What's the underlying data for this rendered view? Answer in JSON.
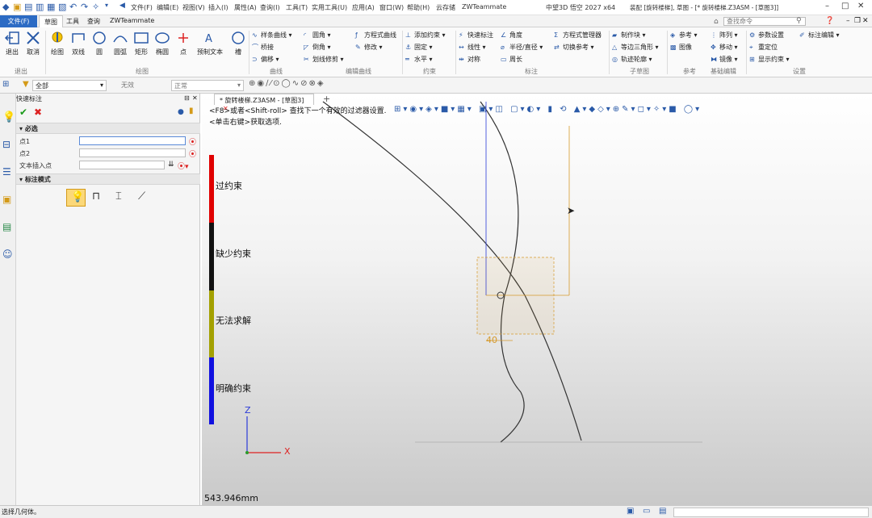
{
  "titlebar": {
    "menus": [
      "文件(F)",
      "编辑(E)",
      "视图(V)",
      "插入(I)",
      "属性(A)",
      "查询(I)",
      "工具(T)",
      "实用工具(U)",
      "应用(A)",
      "窗口(W)",
      "帮助(H)",
      "云存储",
      "ZWTeammate"
    ],
    "app_title": "中望3D 悟空 2027 x64",
    "doc_title": "装配 [旋转楼梯], 草图 - [* 旋转楼梯.Z3ASM - [草图3]]"
  },
  "tabs": {
    "file": "文件(F)",
    "items": [
      "草图",
      "工具",
      "查询",
      "ZWTeammate"
    ],
    "search_placeholder": "查找命令"
  },
  "ribbon": {
    "exit": "退出",
    "cancel": "取消",
    "draw": "绘图",
    "polyline": "双线",
    "circle": "圆",
    "arc": "圆弧",
    "rect": "矩形",
    "ellipse": "椭圆",
    "point": "点",
    "predraw_text": "预制文本",
    "slot": "槽",
    "spline": "样条曲线",
    "bridge": "桥接",
    "offset": "偏移",
    "fillet": "圆角",
    "chamfer": "倒角",
    "trim": "划线修剪",
    "eq_curve": "方程式曲线",
    "modify": "修改",
    "add_constraint": "添加约束",
    "fixed": "固定",
    "horizontal": "水平",
    "quick_dim": "快速标注",
    "linear": "线性",
    "symmetric": "对称",
    "angle": "角度",
    "radius": "半径/直径",
    "perimeter": "周长",
    "eq_manager": "方程式管理器",
    "switch_ref": "切换参考",
    "make_block": "制作块",
    "equal_tri": "等边三角形",
    "track_contour": "轨迹轮廓",
    "reference": "参考",
    "image": "图像",
    "array": "阵列",
    "move": "移动",
    "mirror": "镜像",
    "param_settings": "参数设置",
    "relocate": "重定位",
    "show_constraint": "显示约束",
    "dim_edit": "标注编辑",
    "groups": [
      "退出",
      "绘图",
      "曲线",
      "编辑曲线",
      "约束",
      "标注",
      "子草图",
      "参考",
      "基础编辑",
      "设置"
    ]
  },
  "filterbar": {
    "filter_value": "全部",
    "invalid": "无效",
    "normal": "正常"
  },
  "panel": {
    "title": "快速标注",
    "required": "必选",
    "point1": "点1",
    "point2": "点2",
    "text_insert": "文本插入点",
    "mode": "标注模式"
  },
  "doc_tab": "* 旋转楼梯.Z3ASM - [草图3]",
  "viewport": {
    "hint1": "<F8>或者<Shift-roll> 查找下一个有效的过滤器设置.",
    "hint2": "<单击右键>获取选项.",
    "dim_value": "40",
    "scale_readout": "543.946mm",
    "axis_z": "Z",
    "axis_x": "X"
  },
  "legend": [
    {
      "label": "过约束",
      "color": "#e00000"
    },
    {
      "label": "缺少约束",
      "color": "#111111"
    },
    {
      "label": "无法求解",
      "color": "#a3a000"
    },
    {
      "label": "明确约束",
      "color": "#1010e0"
    }
  ],
  "statusbar": {
    "message": "选择几何体。"
  },
  "colors": {
    "accent": "#2c6bc4",
    "dimension": "#d69a2b"
  }
}
